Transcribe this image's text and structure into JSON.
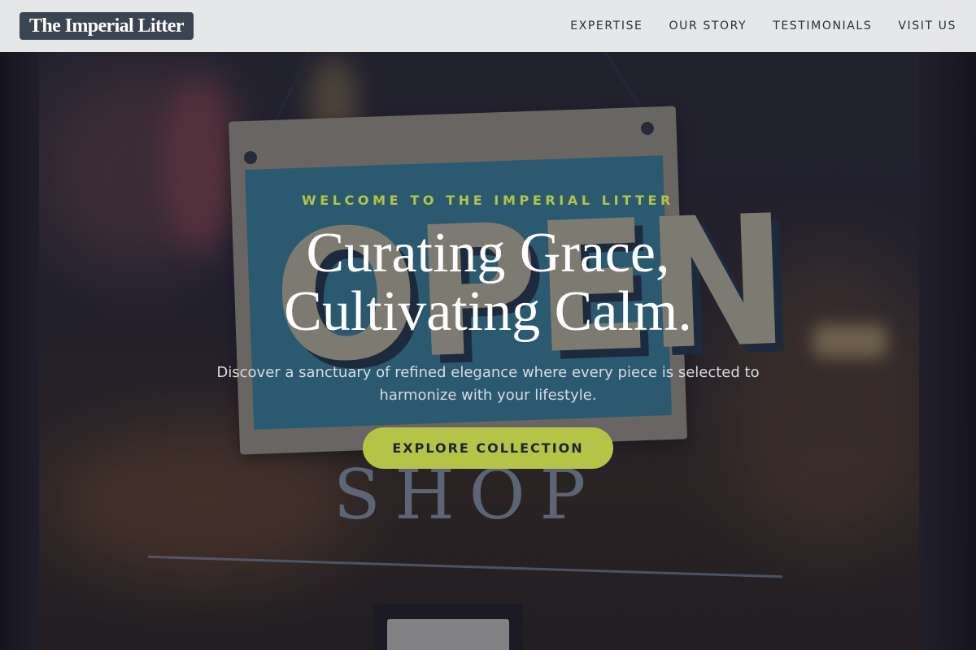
{
  "header": {
    "brand": "The Imperial Litter",
    "nav": [
      {
        "label": "EXPERTISE"
      },
      {
        "label": "OUR STORY"
      },
      {
        "label": "TESTIMONIALS"
      },
      {
        "label": "VISIT US"
      }
    ]
  },
  "hero": {
    "eyebrow": "WELCOME TO THE IMPERIAL LITTER",
    "headline_line1": "Curating Grace,",
    "headline_line2": "Cultivating Calm.",
    "subtext": "Discover a sanctuary of refined elegance where every piece is selected to harmonize with your lifestyle.",
    "cta_label": "EXPLORE COLLECTION",
    "background_sign_text": "OPEN",
    "background_glass_text": "SHOP"
  },
  "colors": {
    "accent": "#b5c447",
    "header_bg": "#f5f6f8",
    "logo_bg": "#3a4452",
    "text_light": "#ffffff"
  }
}
